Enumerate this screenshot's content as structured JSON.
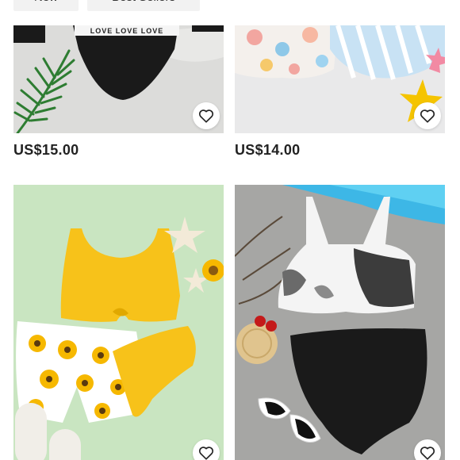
{
  "filters": [
    {
      "label": "New"
    },
    {
      "label": "Best Sellers"
    }
  ],
  "products": [
    {
      "price": "US$15.00",
      "print_text": "LOVE LOVE LOVE"
    },
    {
      "price": "US$14.00"
    },
    {
      "price": ""
    },
    {
      "price": ""
    }
  ],
  "colors": {
    "page_bg": "#ffffff",
    "chip_bg": "#f2f2f2",
    "price_text": "#222222",
    "swim_black": "#1a1a1a",
    "swim_yellow": "#f7c21a",
    "mint_bg": "#c8e6c0"
  },
  "icons": {
    "wishlist": "heart-outline-icon"
  }
}
